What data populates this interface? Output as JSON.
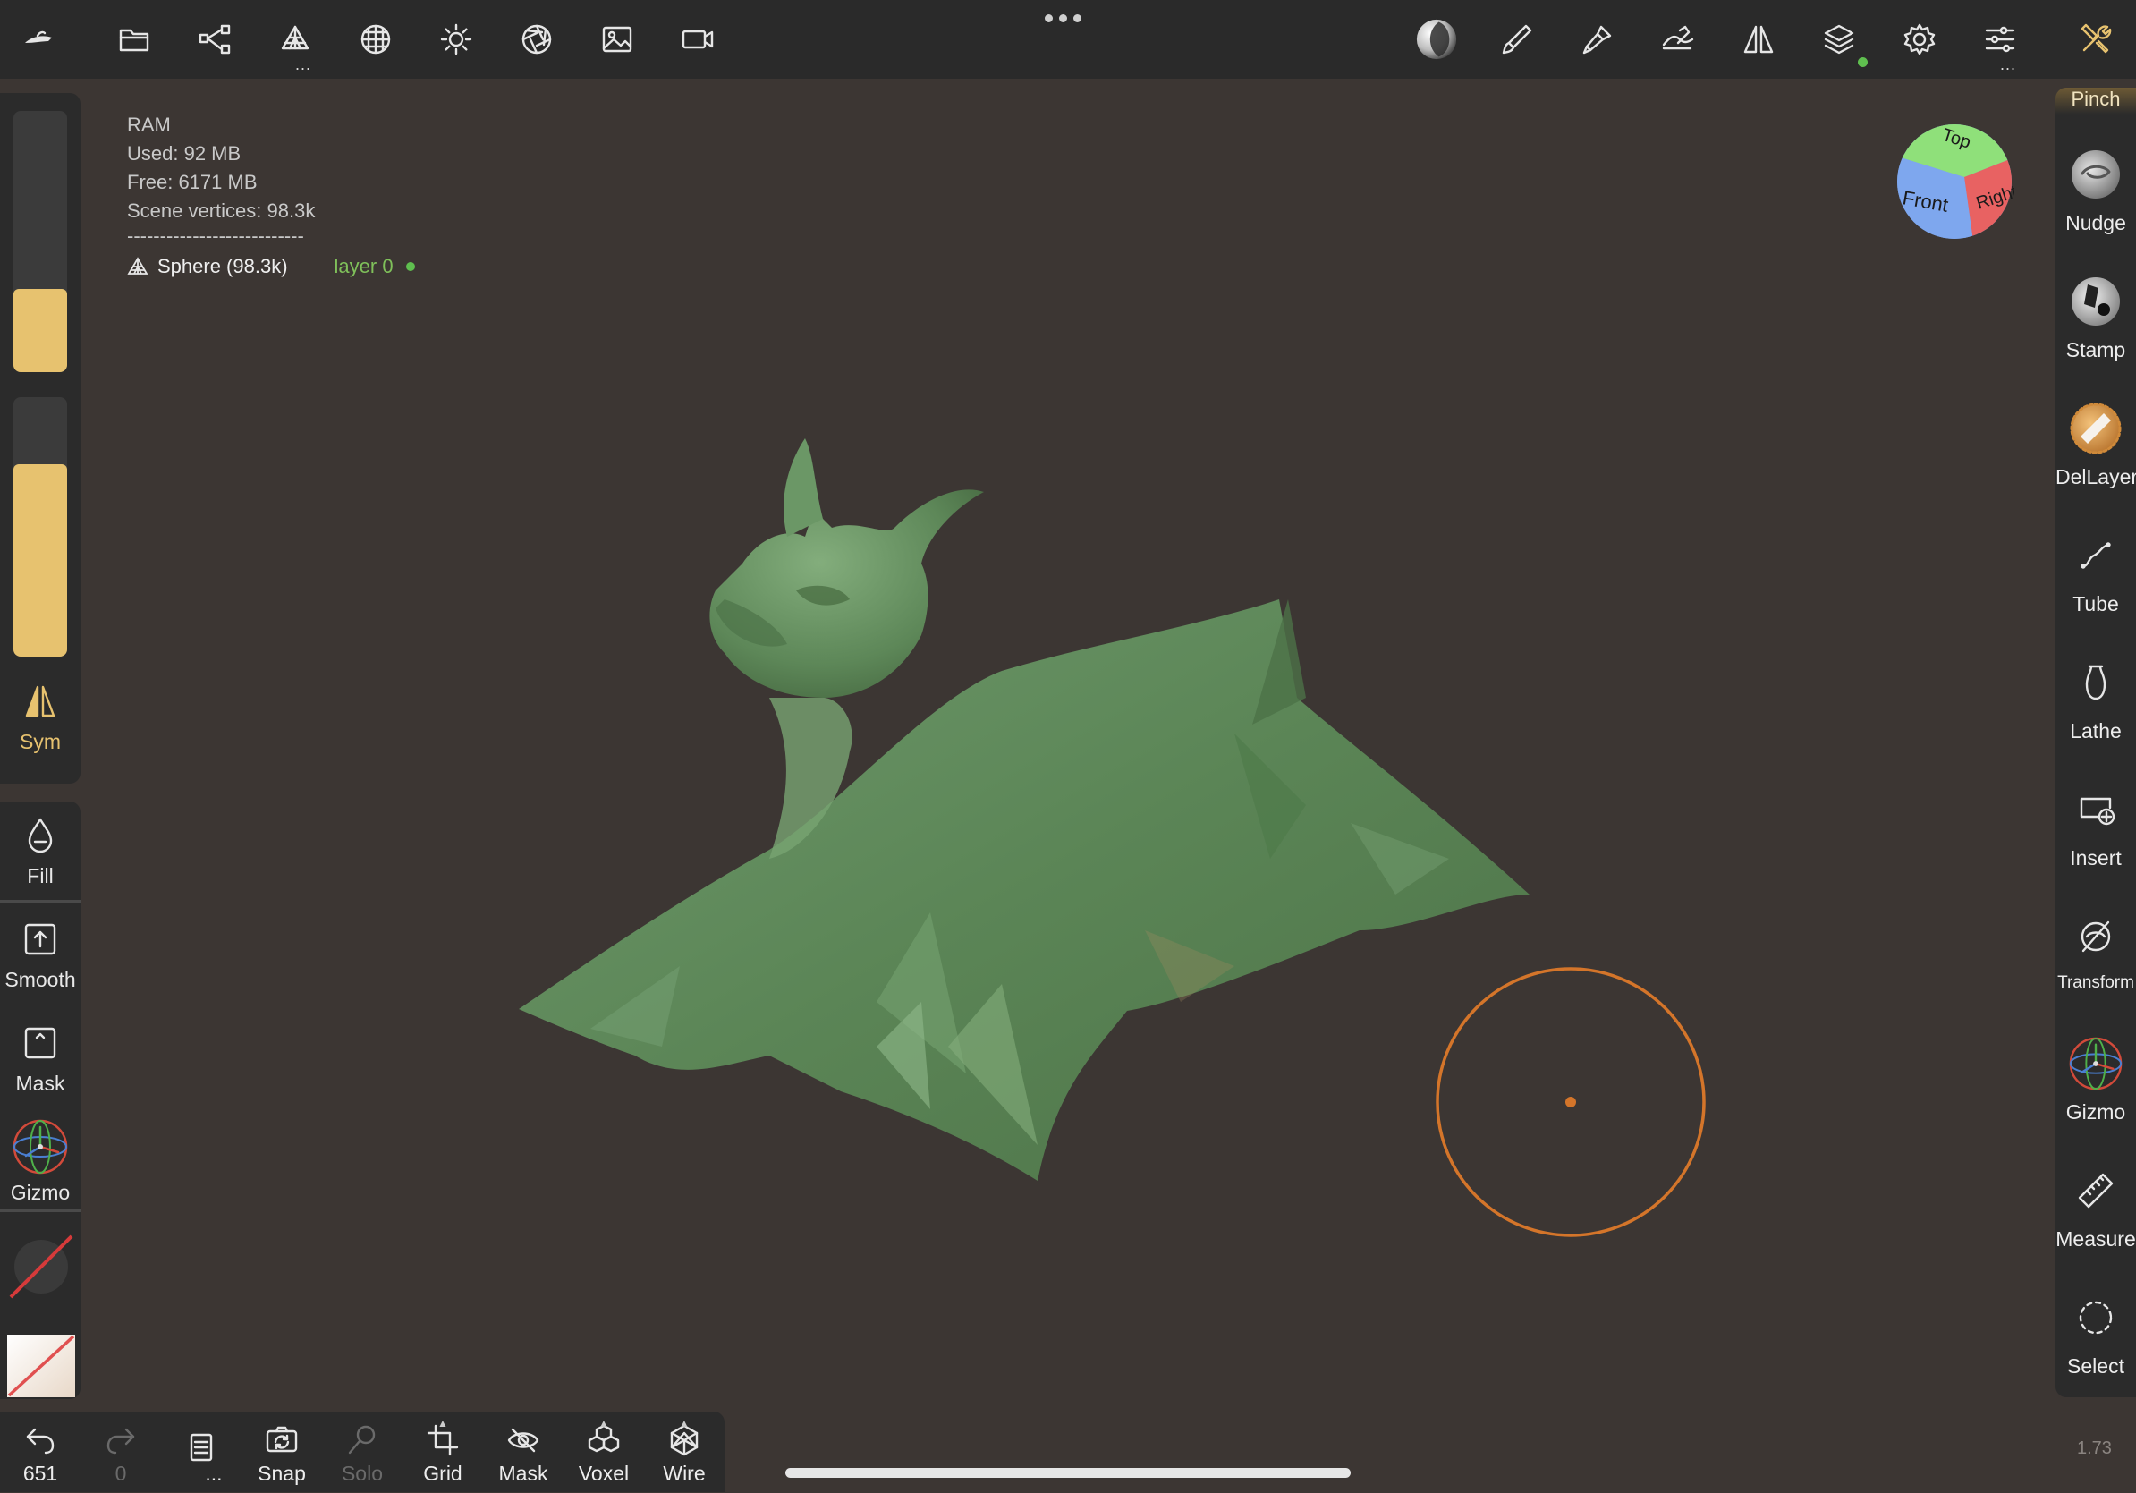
{
  "top_bar": {
    "icons": [
      {
        "name": "app-logo-icon"
      },
      {
        "name": "files-icon"
      },
      {
        "name": "scene-tree-icon"
      },
      {
        "name": "scene-icon",
        "has_more": true
      },
      {
        "name": "topology-icon"
      },
      {
        "name": "light-icon"
      },
      {
        "name": "camera-aperture-icon"
      },
      {
        "name": "background-image-icon"
      },
      {
        "name": "video-icon"
      },
      {
        "name": "material-sphere-icon"
      },
      {
        "name": "brush-icon"
      },
      {
        "name": "paint-icon"
      },
      {
        "name": "stroke-icon"
      },
      {
        "name": "symmetry-icon"
      },
      {
        "name": "layers-icon",
        "status_dot": true
      },
      {
        "name": "settings-gear-icon"
      },
      {
        "name": "sliders-icon",
        "has_more": true
      },
      {
        "name": "tools-icon"
      }
    ],
    "more_dots": "...",
    "status_color": "#5fbf4f"
  },
  "left_panel": {
    "size_slider_level": 0.32,
    "intensity_slider_level": 0.74,
    "sym_label": "Sym",
    "tools": [
      {
        "label": "Fill"
      },
      {
        "label": "Smooth"
      },
      {
        "label": "Mask"
      },
      {
        "label": "Gizmo"
      }
    ],
    "accent_color": "#e7c26f"
  },
  "right_panel": {
    "top_label": "Pinch",
    "tools": [
      {
        "label": "Nudge"
      },
      {
        "label": "Stamp"
      },
      {
        "label": "DelLayer"
      },
      {
        "label": "Tube"
      },
      {
        "label": "Lathe"
      },
      {
        "label": "Insert"
      },
      {
        "label": "Transform"
      },
      {
        "label": "Gizmo"
      },
      {
        "label": "Measure"
      },
      {
        "label": "Select"
      }
    ]
  },
  "info": {
    "ram_label": "RAM",
    "used": "Used: 92 MB",
    "free": "Free: 6171 MB",
    "scene_vertices": "Scene vertices: 98.3k",
    "separator": "---------------------------",
    "object": "Sphere (98.3k)",
    "layer": "layer 0",
    "layer_color": "#7fc05a"
  },
  "view_cube": {
    "top": "Top",
    "front": "Front",
    "right": "Right"
  },
  "brush_cursor": {
    "color": "#d4752a"
  },
  "bottom_bar": {
    "undo": {
      "label": "651"
    },
    "redo": {
      "label": "0"
    },
    "history": {
      "label": "..."
    },
    "snap": {
      "label": "Snap"
    },
    "solo": {
      "label": "Solo"
    },
    "grid": {
      "label": "Grid"
    },
    "mask": {
      "label": "Mask"
    },
    "voxel": {
      "label": "Voxel"
    },
    "wire": {
      "label": "Wire"
    }
  },
  "version": "1.73"
}
